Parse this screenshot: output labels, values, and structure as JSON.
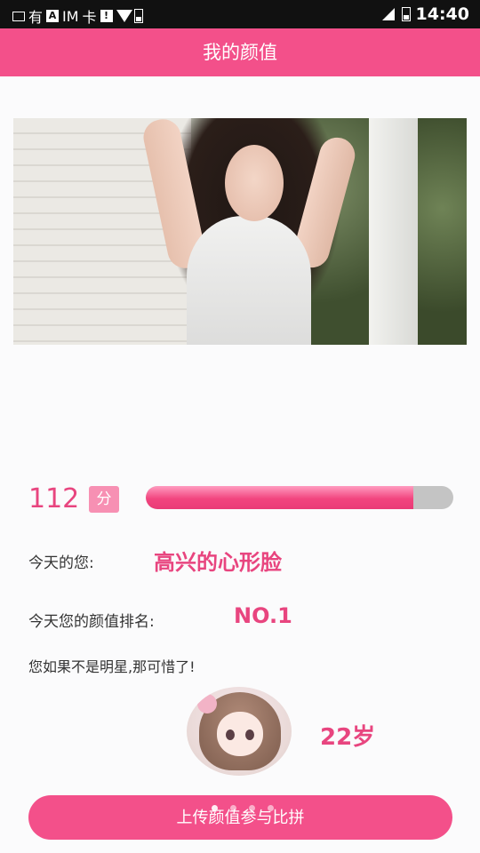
{
  "status_bar": {
    "left_texts": [
      "有",
      "IM",
      "卡"
    ],
    "time": "14:40",
    "icons": [
      "gallery-icon",
      "app-icon",
      "sim-card-icon",
      "wifi-icon",
      "battery-icon",
      "signal-icon"
    ]
  },
  "header": {
    "title": "我的颜值"
  },
  "score": {
    "value": "112",
    "unit": "分",
    "progress_fraction": 0.87
  },
  "rows": [
    {
      "label": "今天的您:",
      "value": "高兴的心形脸"
    },
    {
      "label": "今天您的颜值排名:",
      "value": "NO.1"
    }
  ],
  "comment": "您如果不是明星,那可惜了!",
  "age": "22岁",
  "upload_button": {
    "label": "上传颜值参与比拼"
  },
  "pager": {
    "count": 4,
    "active": 0
  },
  "colors": {
    "accent": "#f3508a",
    "score_text": "#e8457f"
  }
}
